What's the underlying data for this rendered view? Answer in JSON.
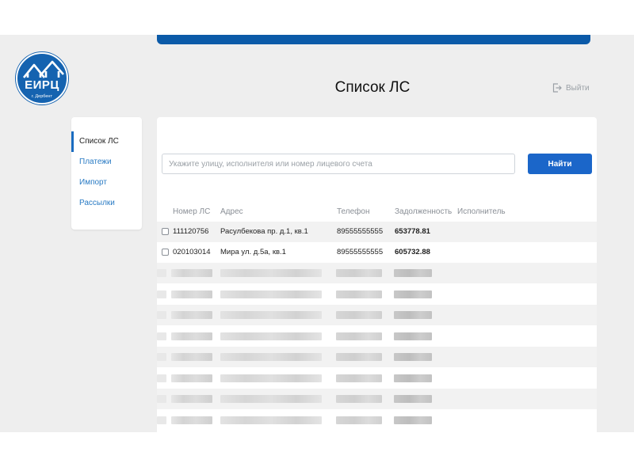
{
  "brand": {
    "logo_title": "ЕИРЦ",
    "logo_subtitle": "г. Дербент",
    "accent_color": "#1b66c9"
  },
  "header": {
    "title": "Список ЛС",
    "logout_label": "Выйти",
    "logout_icon": "logout-icon"
  },
  "sidebar": {
    "items": [
      {
        "label": "Список ЛС",
        "active": true
      },
      {
        "label": "Платежи",
        "active": false
      },
      {
        "label": "Импорт",
        "active": false
      },
      {
        "label": "Рассылки",
        "active": false
      }
    ]
  },
  "search": {
    "placeholder": "Укажите улицу, исполнителя или номер лицевого счета",
    "value": "",
    "button_label": "Найти"
  },
  "table": {
    "headers": [
      "Номер ЛС",
      "Адрес",
      "Телефон",
      "Задолженность",
      "Исполнитель"
    ],
    "rows": [
      {
        "account": "111120756",
        "address": "Расулбекова пр. д.1, кв.1",
        "phone": "89555555555",
        "debt": "653778.81",
        "executor": ""
      },
      {
        "account": "020103014",
        "address": "Мира ул. д.5а, кв.1",
        "phone": "89555555555",
        "debt": "605732.88",
        "executor": ""
      }
    ],
    "blurred_row_count": 8
  }
}
